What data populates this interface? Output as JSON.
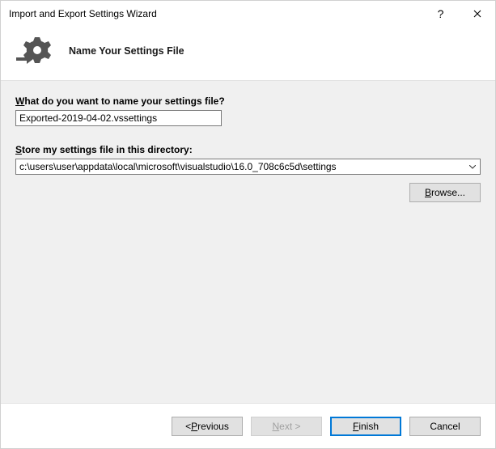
{
  "titlebar": {
    "title": "Import and Export Settings Wizard",
    "help": "?",
    "close": "×"
  },
  "header": {
    "title": "Name Your Settings File"
  },
  "form": {
    "filename_label_pre": "W",
    "filename_label_rest": "hat do you want to name your settings file?",
    "filename_value": "Exported-2019-04-02.vssettings",
    "directory_label_pre": "S",
    "directory_label_rest": "tore my settings file in this directory:",
    "directory_value": "c:\\users\\user\\appdata\\local\\microsoft\\visualstudio\\16.0_708c6c5d\\settings",
    "browse_label_pre": "B",
    "browse_label_rest": "rowse..."
  },
  "footer": {
    "previous_pre": "< ",
    "previous_accel": "P",
    "previous_rest": "revious",
    "next_pre": "",
    "next_accel": "N",
    "next_rest": "ext >",
    "finish_pre": "",
    "finish_accel": "F",
    "finish_rest": "inish",
    "cancel": "Cancel"
  }
}
